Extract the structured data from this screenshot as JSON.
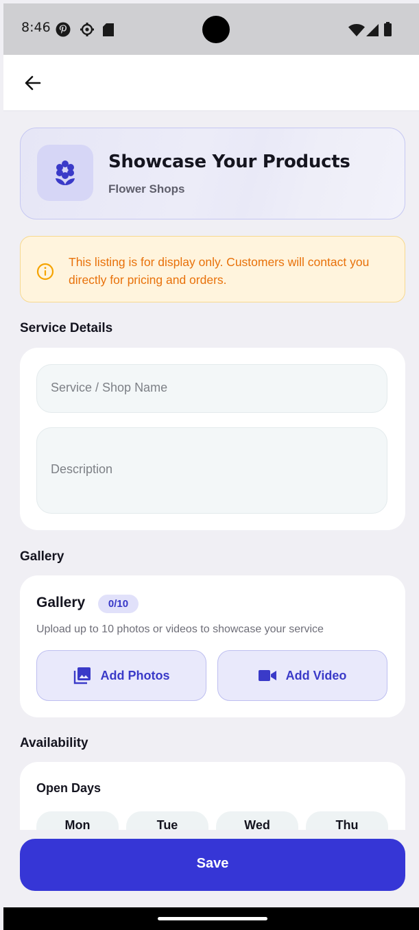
{
  "status_bar": {
    "time": "8:46",
    "icons": [
      "pinterest-icon",
      "settings-gear-icon",
      "sd-card-icon",
      "wifi-icon",
      "cellular-signal-icon",
      "battery-icon"
    ]
  },
  "app_bar": {
    "back_icon": "arrow-left-icon"
  },
  "hero": {
    "icon": "flower-icon",
    "title": "Showcase Your Products",
    "subtitle": "Flower Shops"
  },
  "notice": {
    "icon": "info-circle-icon",
    "text": "This listing is for display only. Customers will contact you directly for pricing and orders."
  },
  "service_details": {
    "section_label": "Service Details",
    "name_placeholder": "Service / Shop Name",
    "name_value": "",
    "description_placeholder": "Description",
    "description_value": ""
  },
  "gallery": {
    "section_label": "Gallery",
    "title": "Gallery",
    "count": "0/10",
    "description": "Upload up to 10 photos or videos to showcase your service",
    "add_photos_label": "Add Photos",
    "add_video_label": "Add Video"
  },
  "availability": {
    "section_label": "Availability",
    "open_days_title": "Open Days",
    "days": [
      "Mon",
      "Tue",
      "Wed",
      "Thu"
    ]
  },
  "save_label": "Save",
  "colors": {
    "accent": "#3636D6",
    "notice_text": "#E8710A",
    "notice_bg": "#FFF4DD",
    "page_bg": "#F0EFF4"
  }
}
